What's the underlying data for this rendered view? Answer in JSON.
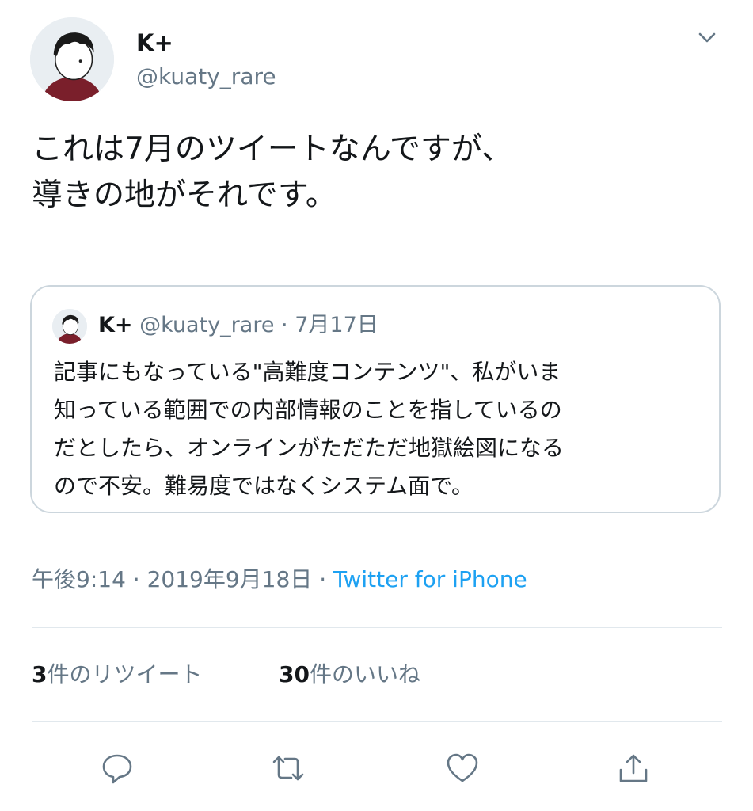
{
  "author": {
    "name": "K+",
    "handle": "@kuaty_rare"
  },
  "tweet": {
    "lines": [
      "これは7月のツイートなんですが、",
      "導きの地がそれです。"
    ]
  },
  "quoted": {
    "name": "K+",
    "handle": "@kuaty_rare",
    "separator": "·",
    "date": "7月17日",
    "lines": [
      "記事にもなっている\"高難度コンテンツ\"、私がいま",
      "知っている範囲での内部情報のことを指しているの",
      "だとしたら、オンラインがただただ地獄絵図になる",
      "ので不安。難易度ではなくシステム面で。"
    ]
  },
  "meta": {
    "time": "午後9:14",
    "sep1": "·",
    "date": "2019年9月18日",
    "sep2": "·",
    "source": "Twitter for iPhone"
  },
  "stats": {
    "retweet_count": "3",
    "retweet_label": "件のリツイート",
    "like_count": "30",
    "like_label": "件のいいね"
  },
  "icons": [
    "chevron-down-icon",
    "reply-icon",
    "retweet-icon",
    "like-icon",
    "share-icon"
  ],
  "colors": {
    "link": "#1da1f2",
    "secondary": "#657786",
    "border": "#ccd6dd",
    "text": "#14171a"
  }
}
